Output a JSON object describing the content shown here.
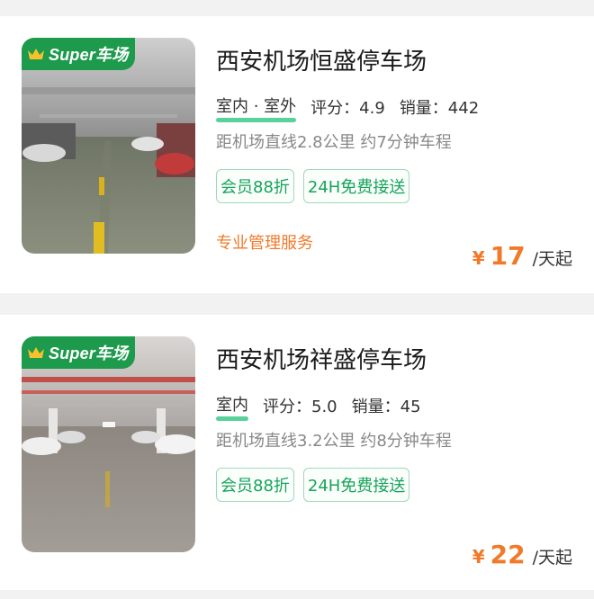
{
  "colors": {
    "brand_green": "#1d9a4c",
    "tag_green": "#17a35a",
    "accent_orange": "#f07a2a"
  },
  "listings": [
    {
      "badge": "Super车场",
      "title": "西安机场恒盛停车场",
      "type": "室内 · 室外",
      "rating_label": "评分：4.9",
      "sales_label": "销量：442",
      "distance": "距机场直线2.8公里 约7分钟车程",
      "tags": [
        "会员88折",
        "24H免费接送"
      ],
      "service": "专业管理服务",
      "currency": "¥",
      "price": "17",
      "unit": "/天起"
    },
    {
      "badge": "Super车场",
      "title": "西安机场祥盛停车场",
      "type": "室内",
      "rating_label": "评分：5.0",
      "sales_label": "销量：45",
      "distance": "距机场直线3.2公里 约8分钟车程",
      "tags": [
        "会员88折",
        "24H免费接送"
      ],
      "currency": "¥",
      "price": "22",
      "unit": "/天起"
    }
  ]
}
